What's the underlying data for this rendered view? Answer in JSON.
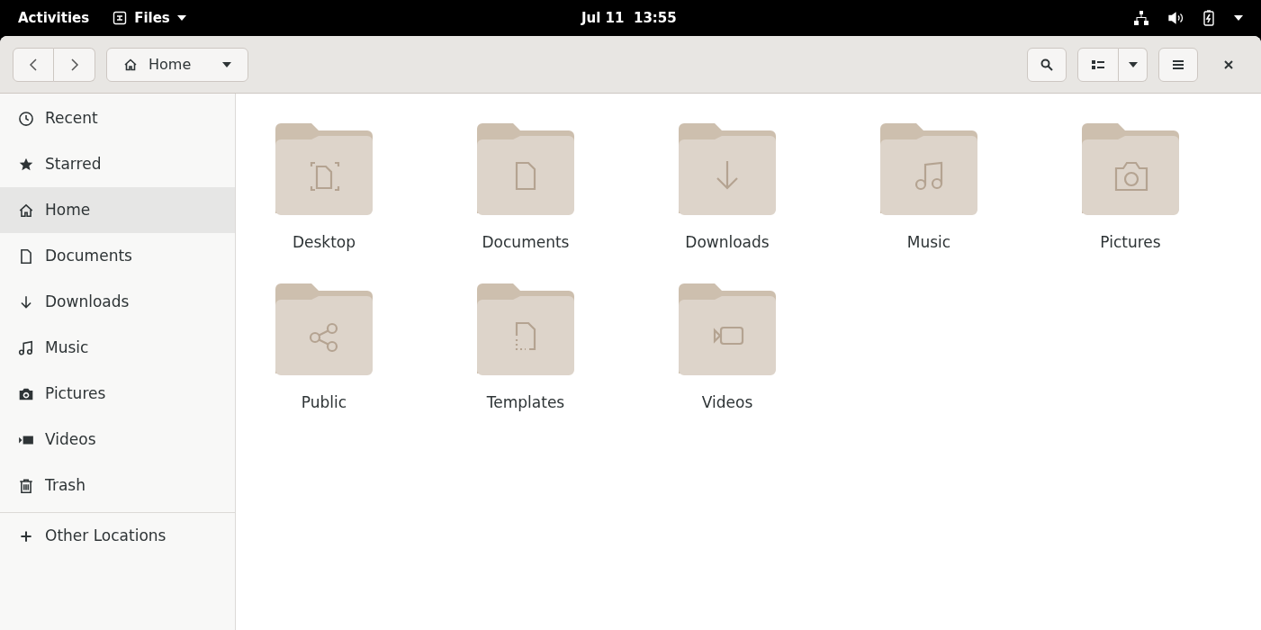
{
  "top_bar": {
    "activities": "Activities",
    "app_menu": "Files",
    "clock": "Jul 11  13:55"
  },
  "header": {
    "location": "Home"
  },
  "sidebar": {
    "items": [
      {
        "label": "Recent",
        "kind": "recent",
        "selected": false
      },
      {
        "label": "Starred",
        "kind": "starred",
        "selected": false
      },
      {
        "label": "Home",
        "kind": "home",
        "selected": true
      },
      {
        "label": "Documents",
        "kind": "documents",
        "selected": false
      },
      {
        "label": "Downloads",
        "kind": "downloads",
        "selected": false
      },
      {
        "label": "Music",
        "kind": "music",
        "selected": false
      },
      {
        "label": "Pictures",
        "kind": "pictures",
        "selected": false
      },
      {
        "label": "Videos",
        "kind": "videos",
        "selected": false
      },
      {
        "label": "Trash",
        "kind": "trash",
        "selected": false
      }
    ],
    "other": {
      "label": "Other Locations",
      "kind": "other",
      "selected": false
    }
  },
  "folders": [
    {
      "name": "Desktop",
      "kind": "desktop"
    },
    {
      "name": "Documents",
      "kind": "documents"
    },
    {
      "name": "Downloads",
      "kind": "downloads"
    },
    {
      "name": "Music",
      "kind": "music"
    },
    {
      "name": "Pictures",
      "kind": "pictures"
    },
    {
      "name": "Public",
      "kind": "public"
    },
    {
      "name": "Templates",
      "kind": "templates"
    },
    {
      "name": "Videos",
      "kind": "videos"
    }
  ]
}
